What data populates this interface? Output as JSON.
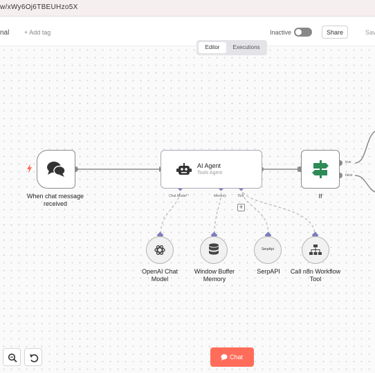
{
  "browser": {
    "url": "w/xWy6Oj6TBEUHzo5X"
  },
  "header": {
    "workflow_name": "nal",
    "add_tag": "+ Add tag",
    "status": "Inactive",
    "share": "Share",
    "save": "Save"
  },
  "tabs": {
    "editor": "Editor",
    "executions": "Executions"
  },
  "nodes": {
    "trigger": {
      "label": "When chat message received",
      "icon": "chat-bubbles-icon"
    },
    "agent": {
      "title": "AI Agent",
      "subtitle": "Tools Agent",
      "icon": "robot-icon"
    },
    "if": {
      "label": "If",
      "icon": "signpost-icon"
    }
  },
  "ports": {
    "chat_model": "Chat Model *",
    "memory": "Memory",
    "tool": "Tool",
    "true": "true",
    "false": "false"
  },
  "subnodes": {
    "openai": {
      "label": "OpenAI Chat Model",
      "icon": "openai-icon"
    },
    "memory": {
      "label": "Window Buffer Memory",
      "icon": "database-icon"
    },
    "serpapi": {
      "label": "SerpAPI",
      "icon_text": "SerpApi"
    },
    "n8n": {
      "label": "Call n8n Workflow Tool",
      "icon": "sitemap-icon"
    }
  },
  "controls": {
    "chat": "Chat"
  },
  "colors": {
    "accent": "#ff6d5a",
    "sub_connector": "#7c7cbf",
    "if_icon": "#2e8b57",
    "trigger_bolt": "#ff6d5a"
  }
}
